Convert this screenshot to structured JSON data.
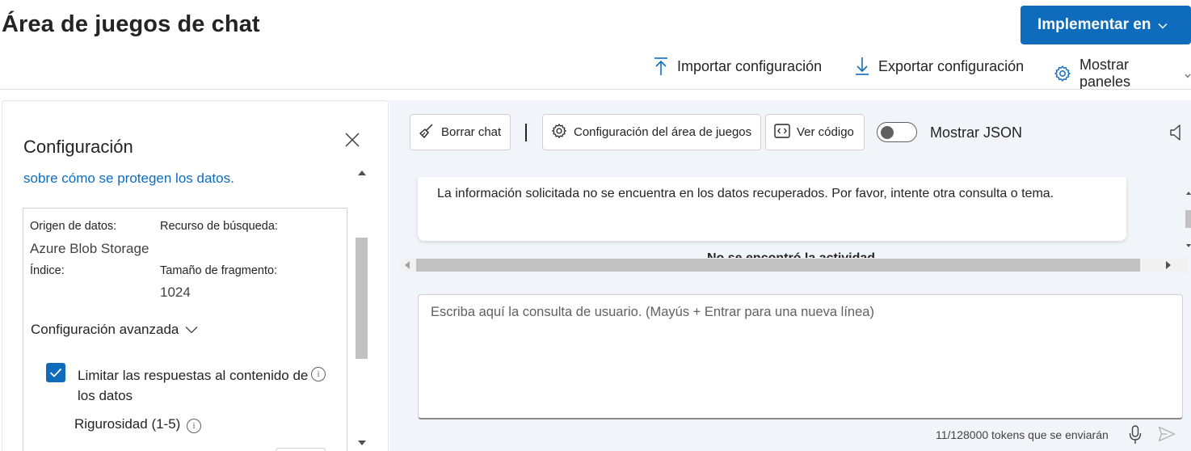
{
  "header": {
    "title": "Área de juegos de chat",
    "deploy_label": "Implementar en",
    "import_label": "Importar configuración",
    "export_label": "Exportar configuración",
    "panels_label": "Mostrar paneles"
  },
  "config": {
    "title": "Configuración",
    "privacy_link": "sobre cómo se protegen los datos.",
    "data_source_label": "Origen de datos:",
    "data_source_value": "Azure Blob Storage",
    "search_resource_label": "Recurso de búsqueda:",
    "index_label": "Índice:",
    "chunk_size_label": "Tamaño de fragmento:",
    "chunk_size_value": "1024",
    "advanced_label": "Configuración avanzada",
    "limit_responses_label": "Limitar las respuestas al contenido de los datos",
    "limit_responses_checked": true,
    "strictness_label": "Rigurosidad (1-5)"
  },
  "chat": {
    "clear_label": "Borrar chat",
    "playground_settings_label": "Configuración del área de juegos",
    "view_code_label": "Ver código",
    "show_json_label": "Mostrar JSON",
    "show_json_on": false,
    "message_text": "La información solicitada no se encuentra en los datos recuperados. Por favor, intente otra consulta o tema.",
    "partial_text": "No se encontró la actividad",
    "query_placeholder": "Escriba aquí la consulta de usuario. (Mayús + Entrar para una nueva línea)",
    "token_count": "11/128000 tokens que se enviarán"
  },
  "colors": {
    "accent": "#0f6cbd",
    "chat_bg": "#f1f4f9"
  }
}
